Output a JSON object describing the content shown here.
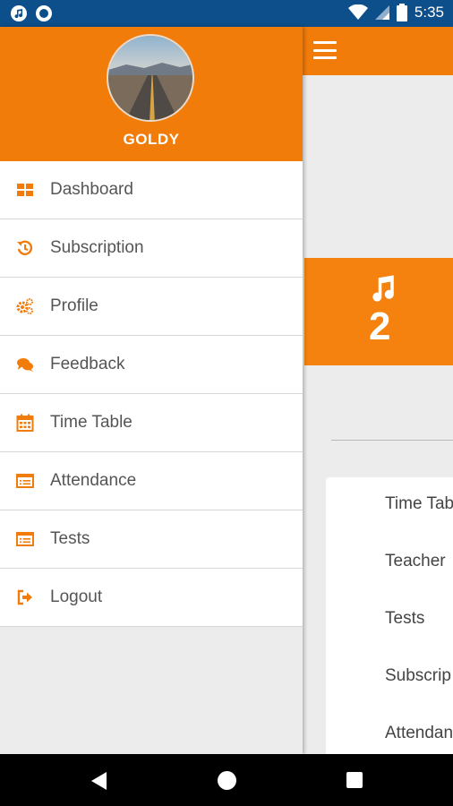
{
  "status_bar": {
    "time": "5:35",
    "left_icons": [
      "music-note-notification-icon",
      "circle-notification-icon"
    ],
    "right_icons": [
      "wifi-icon",
      "cell-signal-icon",
      "battery-icon"
    ]
  },
  "drawer": {
    "username": "GOLDY",
    "avatar": "road-landscape-avatar",
    "menu": [
      {
        "label": "Dashboard",
        "icon": "dashboard-grid-icon"
      },
      {
        "label": "Subscription",
        "icon": "history-icon"
      },
      {
        "label": "Profile",
        "icon": "gears-icon"
      },
      {
        "label": "Feedback",
        "icon": "chat-bubbles-icon"
      },
      {
        "label": "Time Table",
        "icon": "calendar-icon"
      },
      {
        "label": "Attendance",
        "icon": "list-card-icon"
      },
      {
        "label": "Tests",
        "icon": "list-card-icon"
      },
      {
        "label": "Logout",
        "icon": "logout-icon"
      }
    ]
  },
  "app": {
    "card_number": "2",
    "list_items": [
      "Time Tab",
      "Teacher",
      "Tests",
      "Subscrip",
      "Attendan"
    ]
  },
  "colors": {
    "accent": "#f27c0a",
    "status_bar": "#0d4f8b",
    "nav_bar": "#000000"
  }
}
